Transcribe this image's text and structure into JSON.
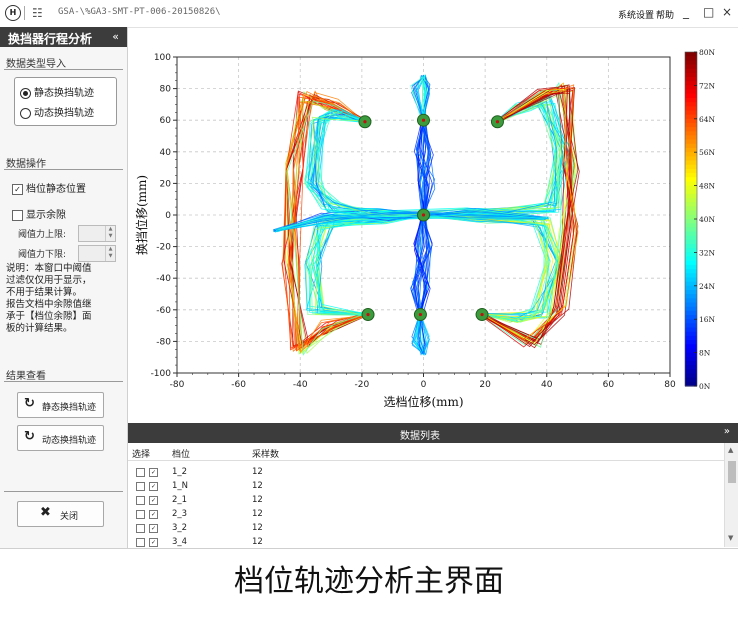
{
  "titlebar": {
    "logo": "H",
    "path": "GSA-\\%GA3-SMT-PT-006-20150826\\",
    "system_settings": "系统设置",
    "help": "帮助",
    "minimize": "_",
    "maximize": "□",
    "close": "×"
  },
  "panel": {
    "title": "换挡器行程分析",
    "collapse": "«",
    "import_section": "数据类型导入",
    "radio_static": "静态换挡轨迹",
    "radio_dynamic": "动态换挡轨迹",
    "ops_section": "数据操作",
    "chk_gear_pos": "档位静态位置",
    "chk_show_margin": "显示余隙",
    "thr_upper": "阈值力上限:",
    "thr_lower": "阈值力下限:",
    "note": "说明：本窗口中阈值\n过滤仅仅用于显示，\n不用于结果计算。\n报告文档中余隙值继\n承于【档位余隙】面\n板的计算结果。",
    "result_section": "结果查看",
    "btn_static": "静态换挡轨迹",
    "btn_dynamic": "动态换挡轨迹",
    "btn_close": "关闭"
  },
  "chart_data": {
    "type": "scatter",
    "xlabel": "选档位移(mm)",
    "ylabel": "换挡位移(mm)",
    "xlim": [
      -80,
      80
    ],
    "ylim": [
      -100,
      100
    ],
    "x_ticks": [
      -80,
      -60,
      -40,
      -20,
      0,
      20,
      40,
      60,
      80
    ],
    "y_ticks": [
      -100,
      -80,
      -60,
      -40,
      -20,
      0,
      20,
      40,
      60,
      80,
      100
    ],
    "grid": true,
    "gear_positions": [
      {
        "x": -19,
        "y": 59
      },
      {
        "x": 0,
        "y": 60
      },
      {
        "x": 24,
        "y": 59
      },
      {
        "x": 0,
        "y": 0
      },
      {
        "x": -18,
        "y": -63
      },
      {
        "x": -1,
        "y": -63
      },
      {
        "x": 19,
        "y": -63
      }
    ],
    "colorbar": {
      "min": 0,
      "max": 80,
      "unit": "N",
      "tick_labels": [
        "80N",
        "72N",
        "64N",
        "56N",
        "48N",
        "40N",
        "32N",
        "24N",
        "16N",
        "8N",
        "0N"
      ]
    }
  },
  "list": {
    "title": "数据列表",
    "collapse": "«",
    "columns": [
      "选择",
      "档位",
      "采样数"
    ],
    "rows": [
      {
        "gear": "1_2",
        "samples": "12"
      },
      {
        "gear": "1_N",
        "samples": "12"
      },
      {
        "gear": "2_1",
        "samples": "12"
      },
      {
        "gear": "2_3",
        "samples": "12"
      },
      {
        "gear": "3_2",
        "samples": "12"
      },
      {
        "gear": "3_4",
        "samples": "12"
      }
    ]
  },
  "caption": "档位轨迹分析主界面"
}
